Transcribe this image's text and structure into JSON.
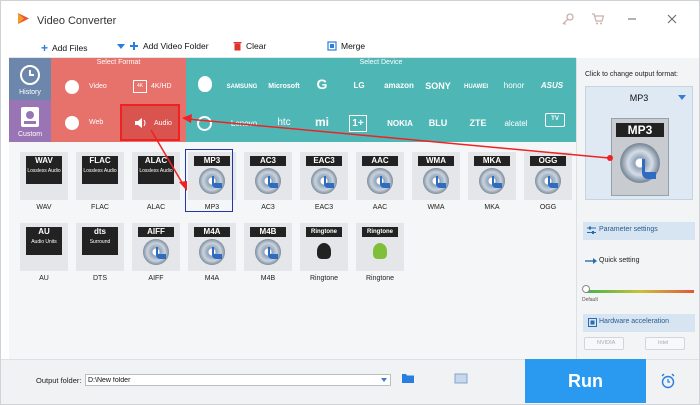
{
  "window": {
    "title": "Video Converter"
  },
  "toolbar": {
    "add_files": "Add Files",
    "add_video_folder": "Add Video Folder",
    "clear": "Clear",
    "merge": "Merge"
  },
  "panels": {
    "select_format": "Select Format",
    "select_device": "Select Device"
  },
  "categories": [
    {
      "label": "History"
    },
    {
      "label": "Custom"
    }
  ],
  "formats": [
    {
      "label": "Video"
    },
    {
      "label": "4K/HD"
    },
    {
      "label": "Web"
    },
    {
      "label": "Audio"
    }
  ],
  "brands_row1": [
    "",
    "SAMSUNG",
    "Microsoft",
    "G",
    "LG",
    "amazon",
    "SONY",
    "HUAWEI",
    "honor",
    "ASUS"
  ],
  "brands_row2": [
    "",
    "Lenovo",
    "htc",
    "mi",
    "1+",
    "NOKIA",
    "BLU",
    "ZTE",
    "alcatel",
    "TV"
  ],
  "audio_tiles_row1": [
    {
      "banner": "WAV",
      "sub": "Lossless Audio",
      "label": "WAV"
    },
    {
      "banner": "FLAC",
      "sub": "Lossless Audio",
      "label": "FLAC"
    },
    {
      "banner": "ALAC",
      "sub": "Lossless Audio",
      "label": "ALAC"
    },
    {
      "banner": "MP3",
      "sub": "",
      "label": "MP3"
    },
    {
      "banner": "AC3",
      "sub": "",
      "label": "AC3"
    },
    {
      "banner": "EAC3",
      "sub": "",
      "label": "EAC3"
    },
    {
      "banner": "AAC",
      "sub": "",
      "label": "AAC"
    },
    {
      "banner": "WMA",
      "sub": "",
      "label": "WMA"
    },
    {
      "banner": "MKA",
      "sub": "",
      "label": "MKA"
    },
    {
      "banner": "OGG",
      "sub": "",
      "label": "OGG"
    }
  ],
  "audio_tiles_row2": [
    {
      "banner": "AU",
      "sub": "Audio Units",
      "label": "AU"
    },
    {
      "banner": "dts",
      "sub": "Surround",
      "label": "DTS"
    },
    {
      "banner": "AIFF",
      "sub": "",
      "label": "AIFF"
    },
    {
      "banner": "M4A",
      "sub": "",
      "label": "M4A"
    },
    {
      "banner": "M4B",
      "sub": "",
      "label": "M4B"
    },
    {
      "banner": "Ringtone",
      "sub": "",
      "label": "Ringtone"
    },
    {
      "banner": "Ringtone",
      "sub": "",
      "label": "Ringtone"
    }
  ],
  "right_panel": {
    "hint": "Click to change output format:",
    "selected_format": "MP3",
    "format_banner": "MP3",
    "parameter_settings": "Parameter settings",
    "quick_setting": "Quick setting",
    "default_label": "Default",
    "hardware_acceleration": "Hardware acceleration",
    "nvidia": "NVIDIA",
    "intel": "Intel"
  },
  "bottom": {
    "output_folder_label": "Output folder:",
    "output_folder_value": "D:\\New folder",
    "run": "Run"
  },
  "colors": {
    "salmon": "#e7726b",
    "teal": "#4fb6b6",
    "category": "#6b82a6",
    "run": "#2a9af0",
    "annotation": "#e22222"
  }
}
